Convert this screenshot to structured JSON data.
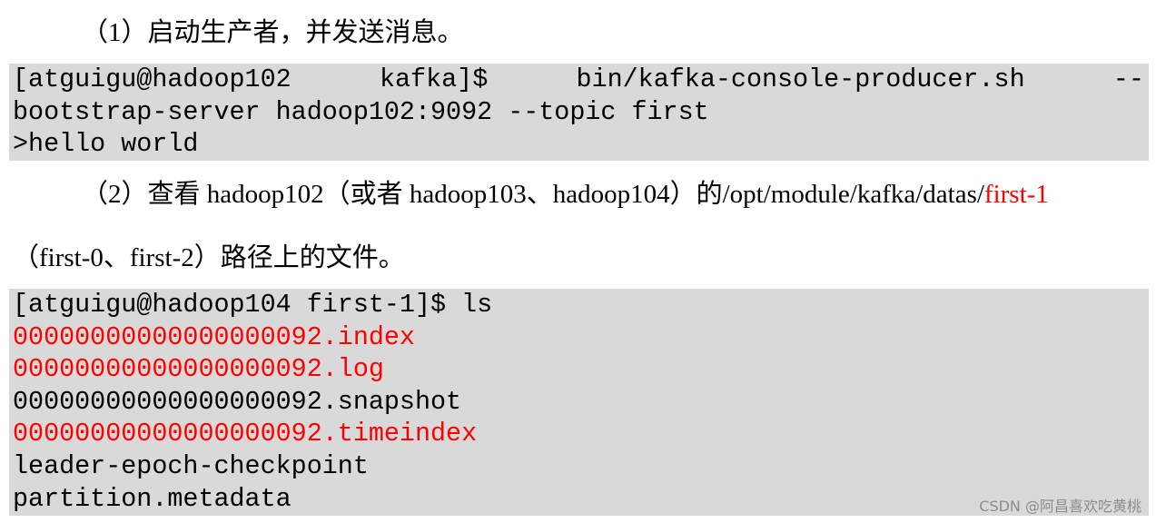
{
  "step1": {
    "text": "（1）启动生产者，并发送消息。"
  },
  "code1": {
    "line1_parts": [
      "[atguigu@hadoop102",
      "kafka]$",
      "bin/kafka-console-producer.sh",
      "--"
    ],
    "line2": "bootstrap-server hadoop102:9092 --topic first",
    "line3": ">hello world"
  },
  "step2": {
    "prefix": "（2）查看  hadoop102（或者  hadoop103、hadoop104）的/opt/module/kafka/datas/",
    "highlight": "first-1",
    "line2": "（first-0、first-2）路径上的文件。"
  },
  "code2": {
    "prompt": "[atguigu@hadoop104 first-1]$ ls",
    "files": [
      {
        "name": "00000000000000000092.index",
        "highlight": true
      },
      {
        "name": "00000000000000000092.log",
        "highlight": true
      },
      {
        "name": "00000000000000000092.snapshot",
        "highlight": false
      },
      {
        "name": "00000000000000000092.timeindex",
        "highlight": true
      },
      {
        "name": "leader-epoch-checkpoint",
        "highlight": false
      },
      {
        "name": "partition.metadata",
        "highlight": false
      }
    ]
  },
  "watermark": "CSDN @阿昌喜欢吃黄桃",
  "colors": {
    "code_background": "#d9d9d9",
    "highlight_red": "#ff0000",
    "text": "#000000",
    "watermark": "#8c8c8c"
  }
}
